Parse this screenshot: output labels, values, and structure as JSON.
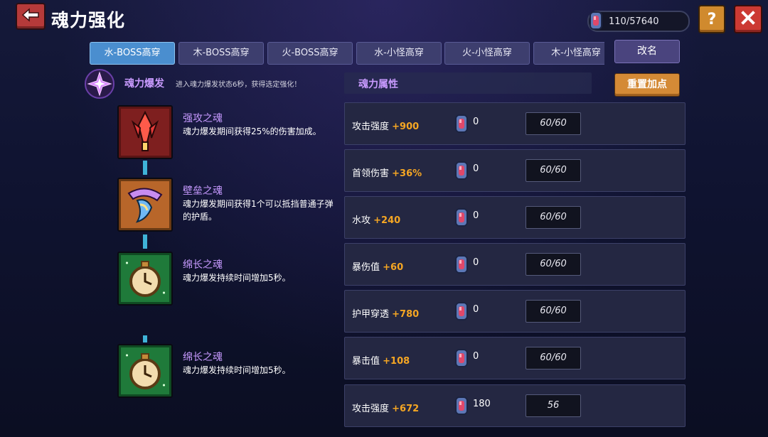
{
  "header": {
    "title": "魂力强化",
    "currency_value": "110/57640",
    "help_label": "?",
    "back_icon": "back-arrow-icon",
    "close_icon": "close-icon"
  },
  "tabs": [
    {
      "label": "水-BOSS高穿",
      "active": true
    },
    {
      "label": "木-BOSS高穿",
      "active": false
    },
    {
      "label": "火-BOSS高穿",
      "active": false
    },
    {
      "label": "水-小怪高穿",
      "active": false
    },
    {
      "label": "火-小怪高穿",
      "active": false
    },
    {
      "label": "木-小怪高穿",
      "active": false
    }
  ],
  "rename_label": "改名",
  "burst": {
    "title": "魂力爆发",
    "desc": "进入魂力爆发状态6秒，获得选定强化！"
  },
  "skills": [
    {
      "name": "强攻之魂",
      "desc": "魂力爆发期间获得25%的伤害加成。",
      "icon": "attack-soul-icon"
    },
    {
      "name": "壁垒之魂",
      "desc": "魂力爆发期间获得1个可以抵挡普通子弹的护盾。",
      "icon": "shield-soul-icon"
    },
    {
      "name": "绵长之魂",
      "desc": "魂力爆发持续时间增加5秒。",
      "icon": "stopwatch-icon"
    },
    {
      "name": "绵长之魂",
      "desc": "魂力爆发持续时间增加5秒。",
      "icon": "stopwatch-icon"
    }
  ],
  "attributes_header": "魂力属性",
  "reset_label": "重置加点",
  "attributes": [
    {
      "name": "攻击强度",
      "bonus": "+900",
      "cost": "0",
      "level": "60/60"
    },
    {
      "name": "首领伤害",
      "bonus": "+36%",
      "cost": "0",
      "level": "60/60"
    },
    {
      "name": "水攻",
      "bonus": "+240",
      "cost": "0",
      "level": "60/60"
    },
    {
      "name": "暴伤值",
      "bonus": "+60",
      "cost": "0",
      "level": "60/60"
    },
    {
      "name": "护甲穿透",
      "bonus": "+780",
      "cost": "0",
      "level": "60/60"
    },
    {
      "name": "暴击值",
      "bonus": "+108",
      "cost": "0",
      "level": "60/60"
    },
    {
      "name": "攻击强度",
      "bonus": "+672",
      "cost": "180",
      "level": "56"
    }
  ],
  "colors": {
    "bonus": "#f5a623",
    "skill_name": "#c79aff",
    "tab_active": "#4a8ecf",
    "tab_inactive": "#3d3e6e",
    "connector": "#3fb3d8"
  }
}
